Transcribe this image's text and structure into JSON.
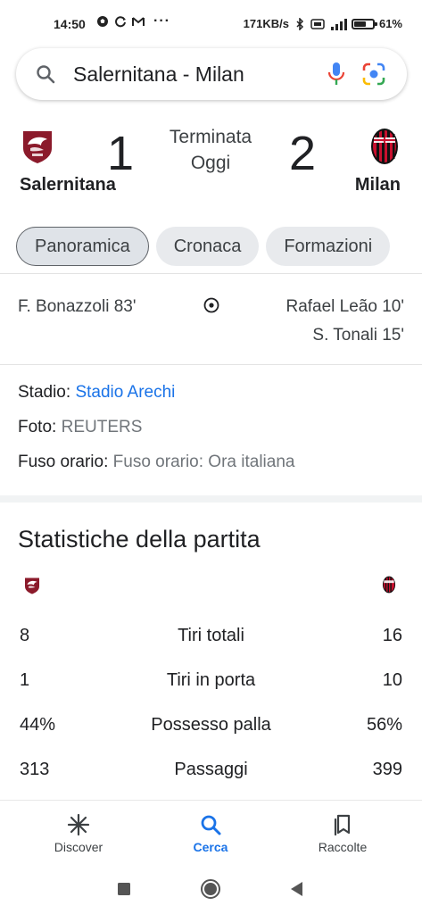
{
  "status_bar": {
    "time": "14:50",
    "dots": "···",
    "net_speed": "171KB/s",
    "battery": "61%",
    "battery_level": 0.61
  },
  "search": {
    "query": "Salernitana - Milan"
  },
  "match": {
    "home_team": "Salernitana",
    "away_team": "Milan",
    "home_score": "1",
    "away_score": "2",
    "status": "Terminata",
    "date": "Oggi",
    "home_color": "#8b1a2b",
    "away_color": "#c8102e"
  },
  "tabs": [
    {
      "label": "Panoramica",
      "active": true
    },
    {
      "label": "Cronaca",
      "active": false
    },
    {
      "label": "Formazioni",
      "active": false
    }
  ],
  "goals": {
    "home": [
      "F. Bonazzoli 83'"
    ],
    "away": [
      "Rafael Leão 10'",
      "S. Tonali 15'"
    ]
  },
  "info": {
    "stadium_label": "Stadio:",
    "stadium_value": "Stadio Arechi",
    "photo_label": "Foto:",
    "photo_value": "REUTERS",
    "timezone_label": "Fuso orario:",
    "timezone_value": "Fuso orario: Ora italiana"
  },
  "stats": {
    "title": "Statistiche della partita",
    "rows": [
      {
        "label": "Tiri totali",
        "home": "8",
        "away": "16"
      },
      {
        "label": "Tiri in porta",
        "home": "1",
        "away": "10"
      },
      {
        "label": "Possesso palla",
        "home": "44%",
        "away": "56%"
      },
      {
        "label": "Passaggi",
        "home": "313",
        "away": "399"
      }
    ]
  },
  "bottom_nav": [
    {
      "label": "Discover",
      "icon": "asterisk-icon",
      "active": false
    },
    {
      "label": "Cerca",
      "icon": "search-icon",
      "active": true
    },
    {
      "label": "Raccolte",
      "icon": "collections-icon",
      "active": false
    }
  ],
  "system_nav": [
    "square-icon",
    "circle-icon",
    "back-triangle-icon"
  ],
  "colors": {
    "accent": "#1a73e8",
    "tab_bg": "#e8eaed"
  }
}
